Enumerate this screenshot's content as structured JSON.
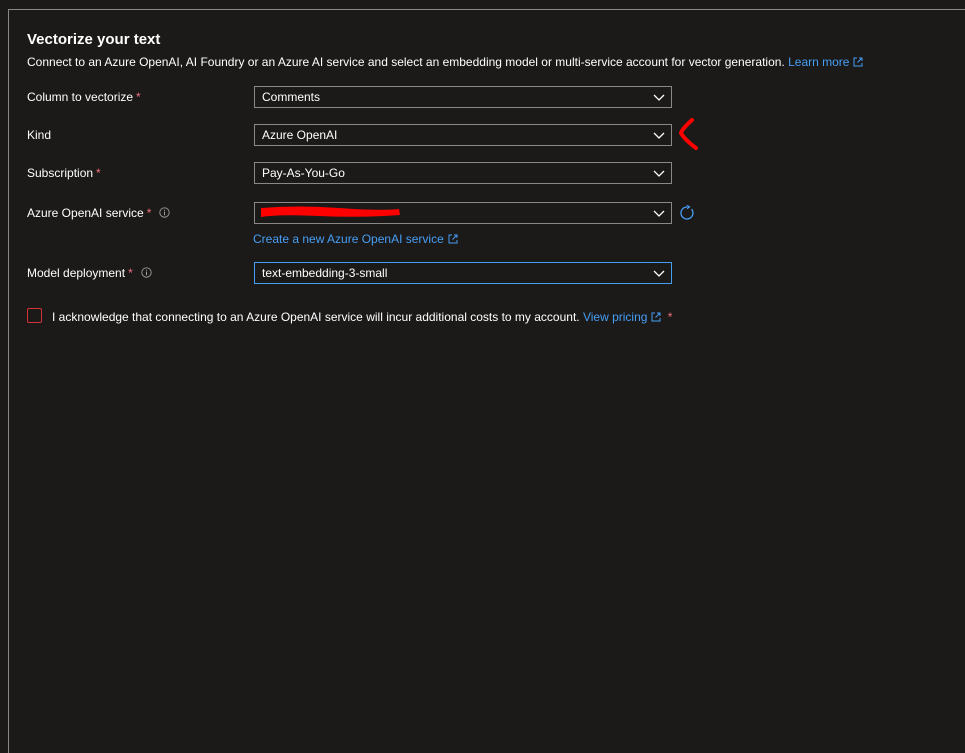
{
  "header": {
    "title": "Vectorize your text",
    "description": "Connect to an Azure OpenAI, AI Foundry or an Azure AI service and select an embedding model or multi-service account for vector generation.",
    "learn_more": "Learn more"
  },
  "fields": {
    "column": {
      "label": "Column to vectorize",
      "required": "*",
      "value": "Comments"
    },
    "kind": {
      "label": "Kind",
      "value": "Azure OpenAI"
    },
    "subscription": {
      "label": "Subscription",
      "required": "*",
      "value": "Pay-As-You-Go"
    },
    "service": {
      "label": "Azure OpenAI service",
      "required": "*",
      "value": ""
    },
    "model": {
      "label": "Model deployment",
      "required": "*",
      "value": "text-embedding-3-small"
    }
  },
  "create_link": "Create a new Azure OpenAI service",
  "acknowledge": {
    "text": "I acknowledge that connecting to an Azure OpenAI service will incur additional costs to my account.",
    "pricing_link": "View pricing",
    "required": "*",
    "checked": false
  },
  "icons": {
    "external": "external-link-icon",
    "info": "info-icon",
    "chevron": "chevron-down-icon",
    "refresh": "refresh-icon"
  },
  "colors": {
    "background": "#1b1a19",
    "link": "#479ef5",
    "required": "#f1707b",
    "border": "#8a8886",
    "focus": "#479ef5",
    "checkbox_error": "#d13438",
    "annotation": "#ff0000"
  }
}
